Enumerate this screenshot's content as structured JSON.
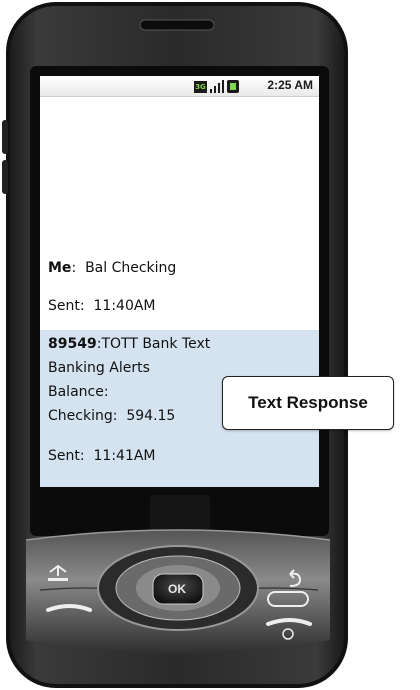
{
  "status_bar": {
    "time": "2:25 AM",
    "network_label": "3G",
    "icons": [
      "network-3g-icon",
      "signal-bars-icon",
      "battery-icon"
    ]
  },
  "conversation": {
    "outgoing": {
      "sender": "Me",
      "message": "Bal Checking",
      "sent_label": "Sent:",
      "sent_time": "11:40AM"
    },
    "incoming": {
      "sender": "89549",
      "line1": "TOTT Bank Text",
      "line2": "Banking Alerts",
      "line3": "Balance:",
      "balance_label": "Checking:",
      "balance_value": "594.15",
      "sent_label": "Sent:",
      "sent_time": "11:41AM"
    },
    "incoming_bg_color": "#d5e3f1"
  },
  "callout": {
    "label": "Text Response"
  },
  "hardware_buttons": {
    "ok_label": "OK",
    "icons": [
      "home-icon",
      "back-icon",
      "call-icon",
      "menu-icon",
      "end-call-icon"
    ]
  }
}
